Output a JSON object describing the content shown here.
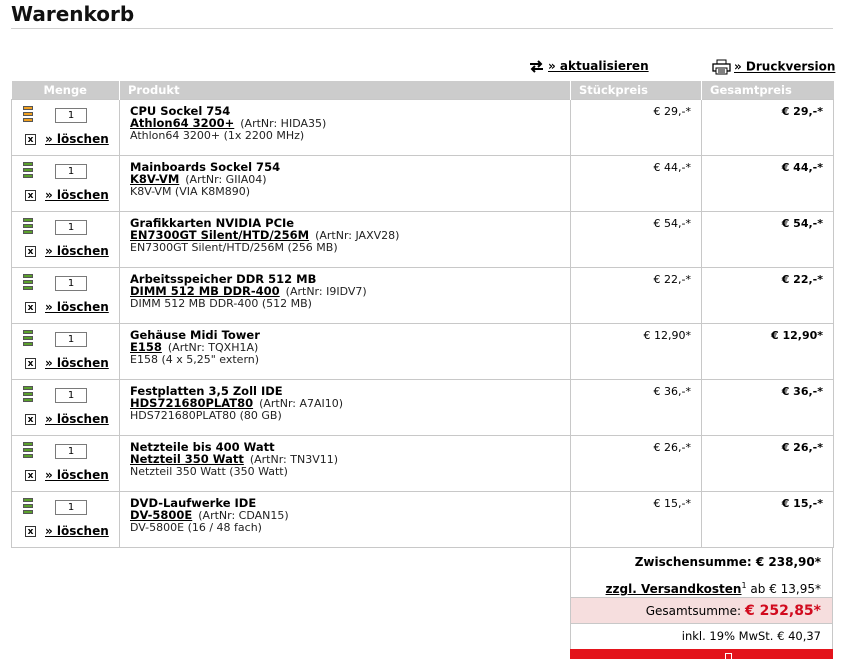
{
  "page": {
    "title": "Warenkorb"
  },
  "actions": {
    "refresh_label": "» aktualisieren",
    "print_label": "» Druckversion"
  },
  "table": {
    "headers": {
      "menge": "Menge",
      "produkt": "Produkt",
      "stueckpreis": "Stückpreis",
      "gesamtpreis": "Gesamtpreis"
    },
    "delete_label": "» löschen",
    "delete_box": "x",
    "rows": [
      {
        "stock": "orange",
        "qty": "1",
        "category": "CPU Sockel 754",
        "name": "Athlon64 3200+",
        "artnr": "(ArtNr: HIDA35)",
        "desc": "Athlon64 3200+ (1x 2200 MHz)",
        "unit": "€ 29,-*",
        "total": "€ 29,-*"
      },
      {
        "stock": "green",
        "qty": "1",
        "category": "Mainboards Sockel 754",
        "name": "K8V-VM",
        "artnr": "(ArtNr: GIIA04)",
        "desc": "K8V-VM (VIA K8M890)",
        "unit": "€ 44,-*",
        "total": "€ 44,-*"
      },
      {
        "stock": "green",
        "qty": "1",
        "category": "Grafikkarten NVIDIA PCIe",
        "name": "EN7300GT Silent/HTD/256M",
        "artnr": "(ArtNr: JAXV28)",
        "desc": "EN7300GT Silent/HTD/256M (256 MB)",
        "unit": "€ 54,-*",
        "total": "€ 54,-*"
      },
      {
        "stock": "green",
        "qty": "1",
        "category": "Arbeitsspeicher DDR 512 MB",
        "name": "DIMM 512 MB DDR-400",
        "artnr": "(ArtNr: I9IDV7)",
        "desc": "DIMM 512 MB DDR-400 (512 MB)",
        "unit": "€ 22,-*",
        "total": "€ 22,-*"
      },
      {
        "stock": "green",
        "qty": "1",
        "category": "Gehäuse Midi Tower",
        "name": "E158",
        "artnr": "(ArtNr: TQXH1A)",
        "desc": "E158 (4 x 5,25\" extern)",
        "unit": "€ 12,90*",
        "total": "€ 12,90*"
      },
      {
        "stock": "green",
        "qty": "1",
        "category": "Festplatten 3,5 Zoll IDE",
        "name": "HDS721680PLAT80",
        "artnr": "(ArtNr: A7AI10)",
        "desc": "HDS721680PLAT80 (80 GB)",
        "unit": "€ 36,-*",
        "total": "€ 36,-*"
      },
      {
        "stock": "green",
        "qty": "1",
        "category": "Netzteile bis 400 Watt",
        "name": "Netzteil 350 Watt",
        "artnr": "(ArtNr: TN3V11)",
        "desc": "Netzteil 350 Watt (350 Watt)",
        "unit": "€ 26,-*",
        "total": "€ 26,-*"
      },
      {
        "stock": "green",
        "qty": "1",
        "category": "DVD-Laufwerke IDE",
        "name": "DV-5800E",
        "artnr": "(ArtNr: CDAN15)",
        "desc": "DV-5800E (16 / 48 fach)",
        "unit": "€ 15,-*",
        "total": "€ 15,-*"
      }
    ]
  },
  "summary": {
    "subtotal_label": "Zwischensumme:",
    "subtotal_value": "€ 238,90*",
    "shipping_label": "zzgl. Versandkosten",
    "shipping_sup": "1",
    "shipping_value": "ab € 13,95*",
    "total_label": "Gesamtsumme:",
    "total_value": "€ 252,85*",
    "vat_text": "inkl. 19% MwSt. € 40,37"
  },
  "colors": {
    "header_bg": "#cccccc",
    "total_red": "#d10a1e",
    "total_bg": "#f6dede",
    "stock_green": "#5aa02c",
    "stock_orange": "#f0a020"
  }
}
